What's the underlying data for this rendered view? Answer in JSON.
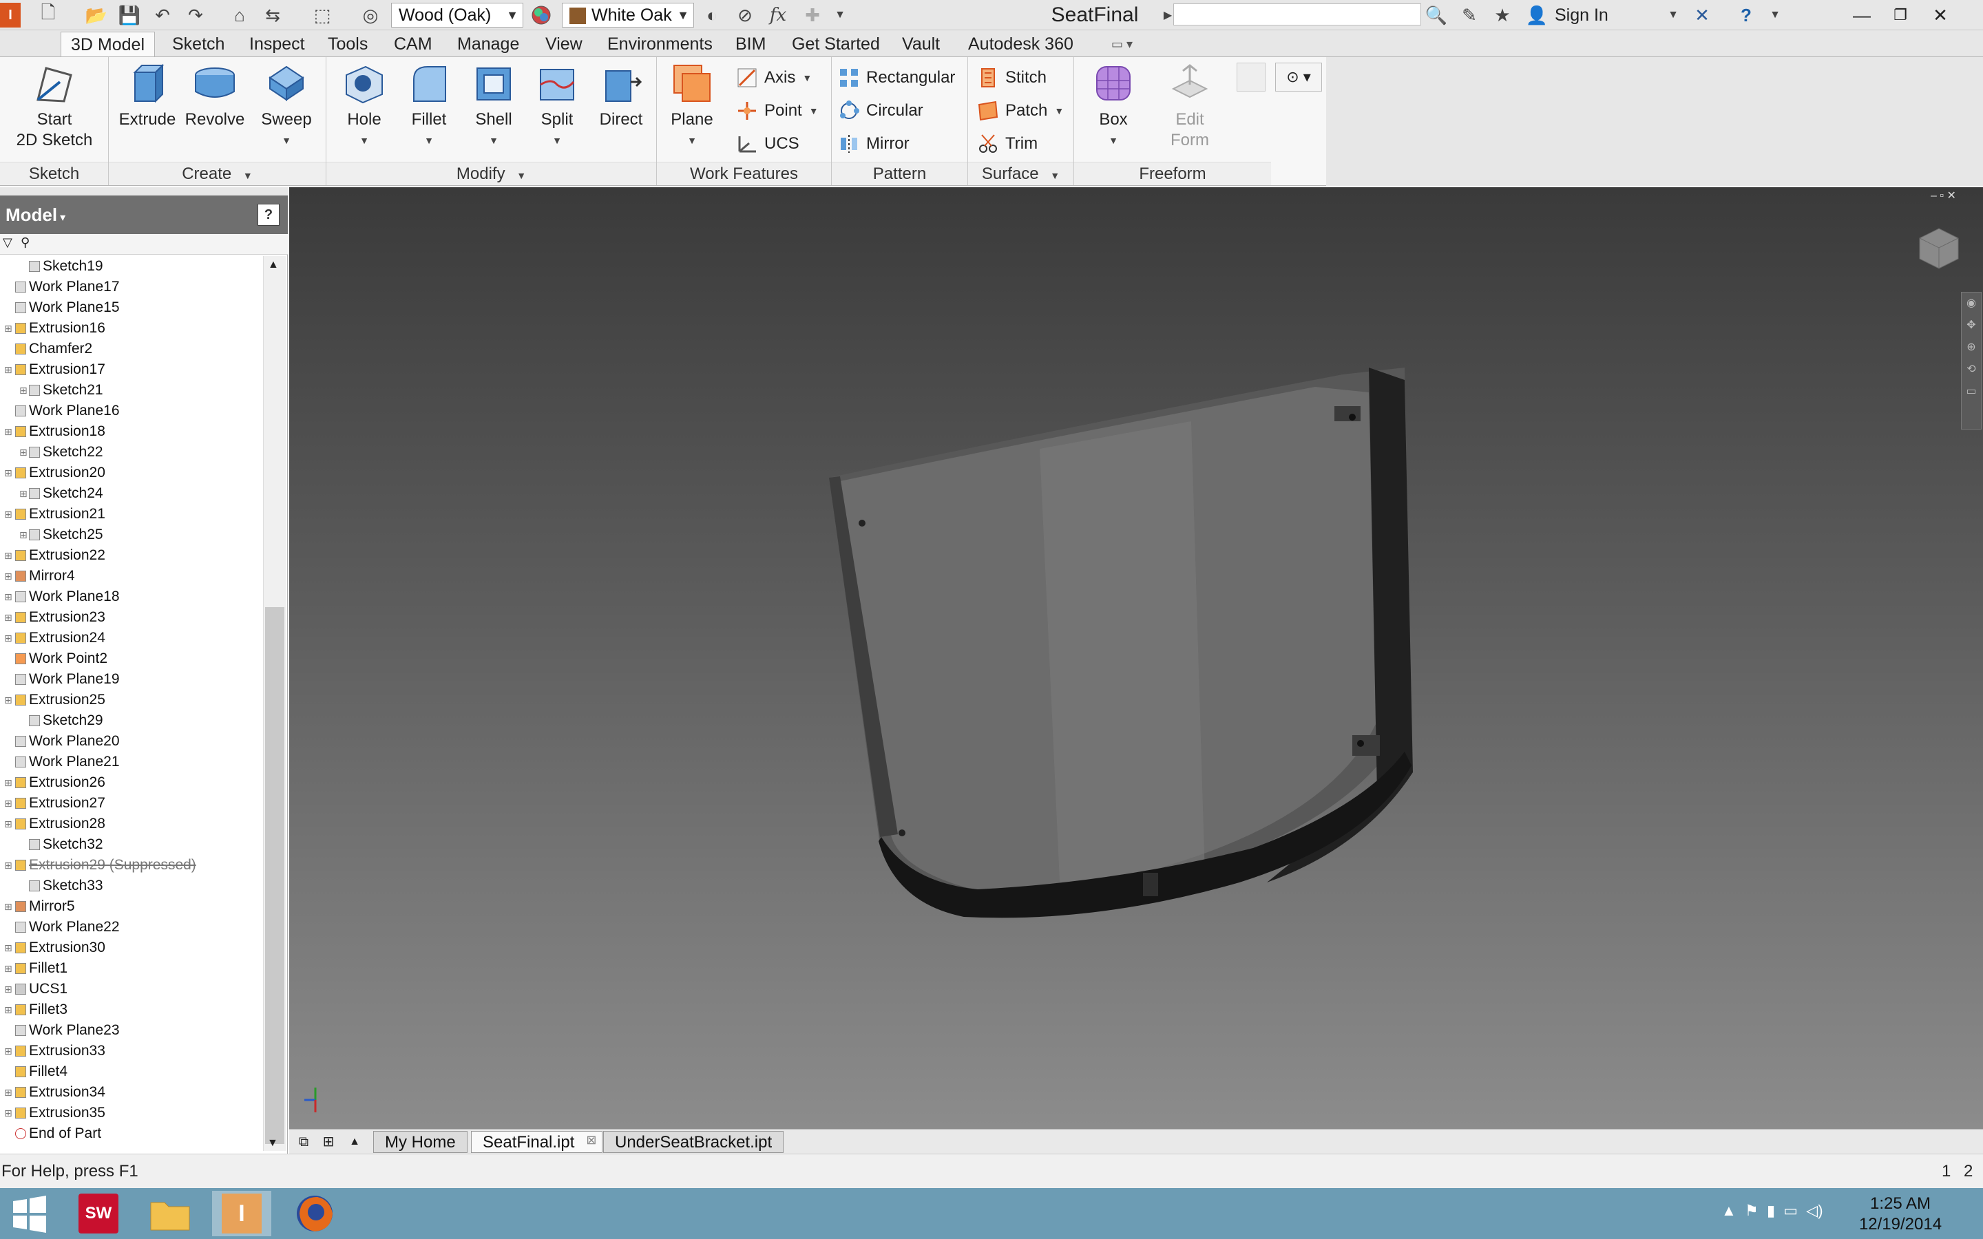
{
  "app": {
    "title": "SeatFinal",
    "material": "Wood (Oak)",
    "appearance": "White Oak",
    "sign_in": "Sign In"
  },
  "ribbon_tabs": [
    "3D Model",
    "Sketch",
    "Inspect",
    "Tools",
    "CAM",
    "Manage",
    "View",
    "Environments",
    "BIM",
    "Get Started",
    "Vault",
    "Autodesk 360"
  ],
  "ribbon": {
    "sketch": {
      "title": "Sketch",
      "start_line1": "Start",
      "start_line2": "2D Sketch"
    },
    "create": {
      "title": "Create",
      "extrude": "Extrude",
      "revolve": "Revolve",
      "sweep": "Sweep"
    },
    "modify": {
      "title": "Modify",
      "hole": "Hole",
      "fillet": "Fillet",
      "shell": "Shell",
      "split": "Split",
      "direct": "Direct"
    },
    "work_features": {
      "title": "Work Features",
      "plane": "Plane",
      "axis": "Axis",
      "point": "Point",
      "ucs": "UCS"
    },
    "pattern": {
      "title": "Pattern",
      "rectangular": "Rectangular",
      "circular": "Circular",
      "mirror": "Mirror"
    },
    "surface": {
      "title": "Surface",
      "stitch": "Stitch",
      "patch": "Patch",
      "trim": "Trim"
    },
    "freeform": {
      "title": "Freeform",
      "box": "Box",
      "edit_form_line1": "Edit",
      "edit_form_line2": "Form"
    }
  },
  "browser": {
    "title": "Model",
    "items": [
      {
        "label": "Sketch19",
        "indent": 1,
        "icon": "sketch",
        "expand": false
      },
      {
        "label": "Work Plane17",
        "indent": 0,
        "icon": "plane",
        "expand": false
      },
      {
        "label": "Work Plane15",
        "indent": 0,
        "icon": "plane",
        "expand": false
      },
      {
        "label": "Extrusion16",
        "indent": 0,
        "icon": "extrude",
        "expand": true
      },
      {
        "label": "Chamfer2",
        "indent": 0,
        "icon": "chamfer",
        "expand": false
      },
      {
        "label": "Extrusion17",
        "indent": 0,
        "icon": "extrude",
        "expand": true
      },
      {
        "label": "Sketch21",
        "indent": 1,
        "icon": "sketch",
        "expand": true
      },
      {
        "label": "Work Plane16",
        "indent": 0,
        "icon": "plane",
        "expand": false
      },
      {
        "label": "Extrusion18",
        "indent": 0,
        "icon": "extrude",
        "expand": true
      },
      {
        "label": "Sketch22",
        "indent": 1,
        "icon": "sketch",
        "expand": true
      },
      {
        "label": "Extrusion20",
        "indent": 0,
        "icon": "extrude",
        "expand": true
      },
      {
        "label": "Sketch24",
        "indent": 1,
        "icon": "sketch",
        "expand": true
      },
      {
        "label": "Extrusion21",
        "indent": 0,
        "icon": "extrude",
        "expand": true
      },
      {
        "label": "Sketch25",
        "indent": 1,
        "icon": "sketch",
        "expand": true
      },
      {
        "label": "Extrusion22",
        "indent": 0,
        "icon": "extrude",
        "expand": true
      },
      {
        "label": "Mirror4",
        "indent": 0,
        "icon": "mirror",
        "expand": true
      },
      {
        "label": "Work Plane18",
        "indent": 0,
        "icon": "plane",
        "expand": true
      },
      {
        "label": "Extrusion23",
        "indent": 0,
        "icon": "extrude",
        "expand": true
      },
      {
        "label": "Extrusion24",
        "indent": 0,
        "icon": "extrude",
        "expand": true
      },
      {
        "label": "Work Point2",
        "indent": 0,
        "icon": "point",
        "expand": false
      },
      {
        "label": "Work Plane19",
        "indent": 0,
        "icon": "plane",
        "expand": false
      },
      {
        "label": "Extrusion25",
        "indent": 0,
        "icon": "extrude",
        "expand": true
      },
      {
        "label": "Sketch29",
        "indent": 1,
        "icon": "sketch",
        "expand": false
      },
      {
        "label": "Work Plane20",
        "indent": 0,
        "icon": "plane",
        "expand": false
      },
      {
        "label": "Work Plane21",
        "indent": 0,
        "icon": "plane",
        "expand": false
      },
      {
        "label": "Extrusion26",
        "indent": 0,
        "icon": "extrude",
        "expand": true
      },
      {
        "label": "Extrusion27",
        "indent": 0,
        "icon": "extrude",
        "expand": true
      },
      {
        "label": "Extrusion28",
        "indent": 0,
        "icon": "extrude",
        "expand": true
      },
      {
        "label": "Sketch32",
        "indent": 1,
        "icon": "sketch",
        "expand": false
      },
      {
        "label": "Extrusion29 (Suppressed)",
        "indent": 0,
        "icon": "extrude",
        "expand": true,
        "suppressed": true
      },
      {
        "label": "Sketch33",
        "indent": 1,
        "icon": "sketch",
        "expand": false
      },
      {
        "label": "Mirror5",
        "indent": 0,
        "icon": "mirror",
        "expand": true
      },
      {
        "label": "Work Plane22",
        "indent": 0,
        "icon": "plane",
        "expand": false
      },
      {
        "label": "Extrusion30",
        "indent": 0,
        "icon": "extrude",
        "expand": true
      },
      {
        "label": "Fillet1",
        "indent": 0,
        "icon": "fillet",
        "expand": true
      },
      {
        "label": "UCS1",
        "indent": 0,
        "icon": "ucs",
        "expand": true
      },
      {
        "label": "Fillet3",
        "indent": 0,
        "icon": "fillet",
        "expand": true
      },
      {
        "label": "Work Plane23",
        "indent": 0,
        "icon": "plane",
        "expand": false
      },
      {
        "label": "Extrusion33",
        "indent": 0,
        "icon": "extrude",
        "expand": true
      },
      {
        "label": "Fillet4",
        "indent": 0,
        "icon": "fillet",
        "expand": false
      },
      {
        "label": "Extrusion34",
        "indent": 0,
        "icon": "extrude",
        "expand": true
      },
      {
        "label": "Extrusion35",
        "indent": 0,
        "icon": "extrude",
        "expand": true
      },
      {
        "label": "End of Part",
        "indent": 0,
        "icon": "end",
        "expand": false
      }
    ]
  },
  "document_tabs": [
    {
      "label": "My Home",
      "active": false
    },
    {
      "label": "SeatFinal.ipt",
      "active": true
    },
    {
      "label": "UnderSeatBracket.ipt",
      "active": false
    }
  ],
  "status": {
    "help": "For Help, press F1",
    "count_a": "1",
    "count_b": "2"
  },
  "taskbar": {
    "time": "1:25 AM",
    "date": "12/19/2014"
  },
  "colors": {
    "accent": "#d9541e",
    "taskbar": "#6c9cb4",
    "panel_header": "#6f6f6f"
  }
}
